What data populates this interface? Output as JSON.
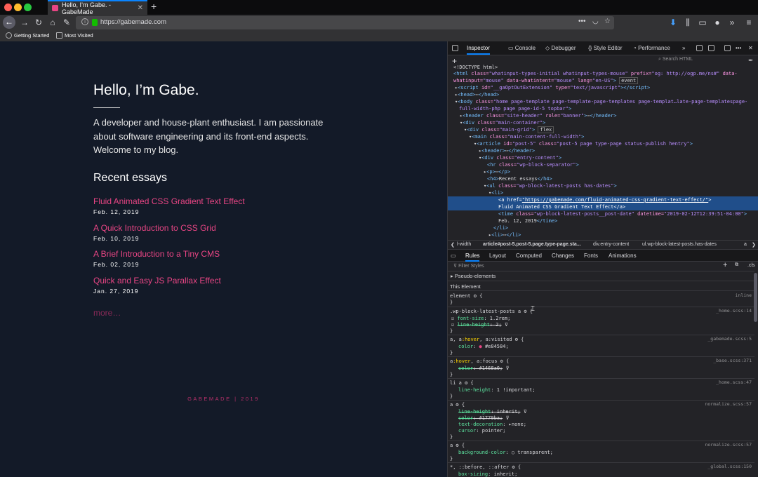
{
  "browser": {
    "tab_title": "Hello, I’m Gabe. - GabeMade",
    "url": "https://gabemade.com",
    "bookmarks": [
      "Getting Started",
      "Most Visited"
    ],
    "more_glyph": "•••"
  },
  "page": {
    "title": "Hello, I’m Gabe.",
    "intro": "A developer and house-plant enthusiast. I am passionate about software engineering and its front-end aspects. Welcome to my blog.",
    "recent_heading": "Recent essays",
    "essays": [
      {
        "title": "Fluid Animated CSS Gradient Text Effect",
        "date": "Feb. 12, 2019"
      },
      {
        "title": "A Quick Introduction to CSS Grid",
        "date": "Feb. 10, 2019"
      },
      {
        "title": "A Brief Introduction to a Tiny CMS",
        "date": "Feb. 02, 2019"
      },
      {
        "title": "Quick and Easy JS Parallax Effect",
        "date": "Jan. 27, 2019"
      }
    ],
    "more_link": "more…",
    "footer": "GABEMADE | 2019",
    "accent_color": "#e84584"
  },
  "devtools": {
    "tabs": [
      "Inspector",
      "Console",
      "Debugger",
      "Style Editor",
      "Performance"
    ],
    "search_placeholder": "Search HTML",
    "breadcrumbs": [
      "l-width",
      "article#post-5.post-5.page.type-page.sta...",
      "div.entry-content",
      "ul.wp-block-latest-posts.has-dates",
      "a"
    ],
    "rules_tabs": [
      "Rules",
      "Layout",
      "Computed",
      "Changes",
      "Fonts",
      "Animations"
    ],
    "filter_placeholder": "Filter Styles",
    "cls_label": ".cls",
    "pseudo_label": "Pseudo-elements",
    "this_element_label": "This Element"
  }
}
